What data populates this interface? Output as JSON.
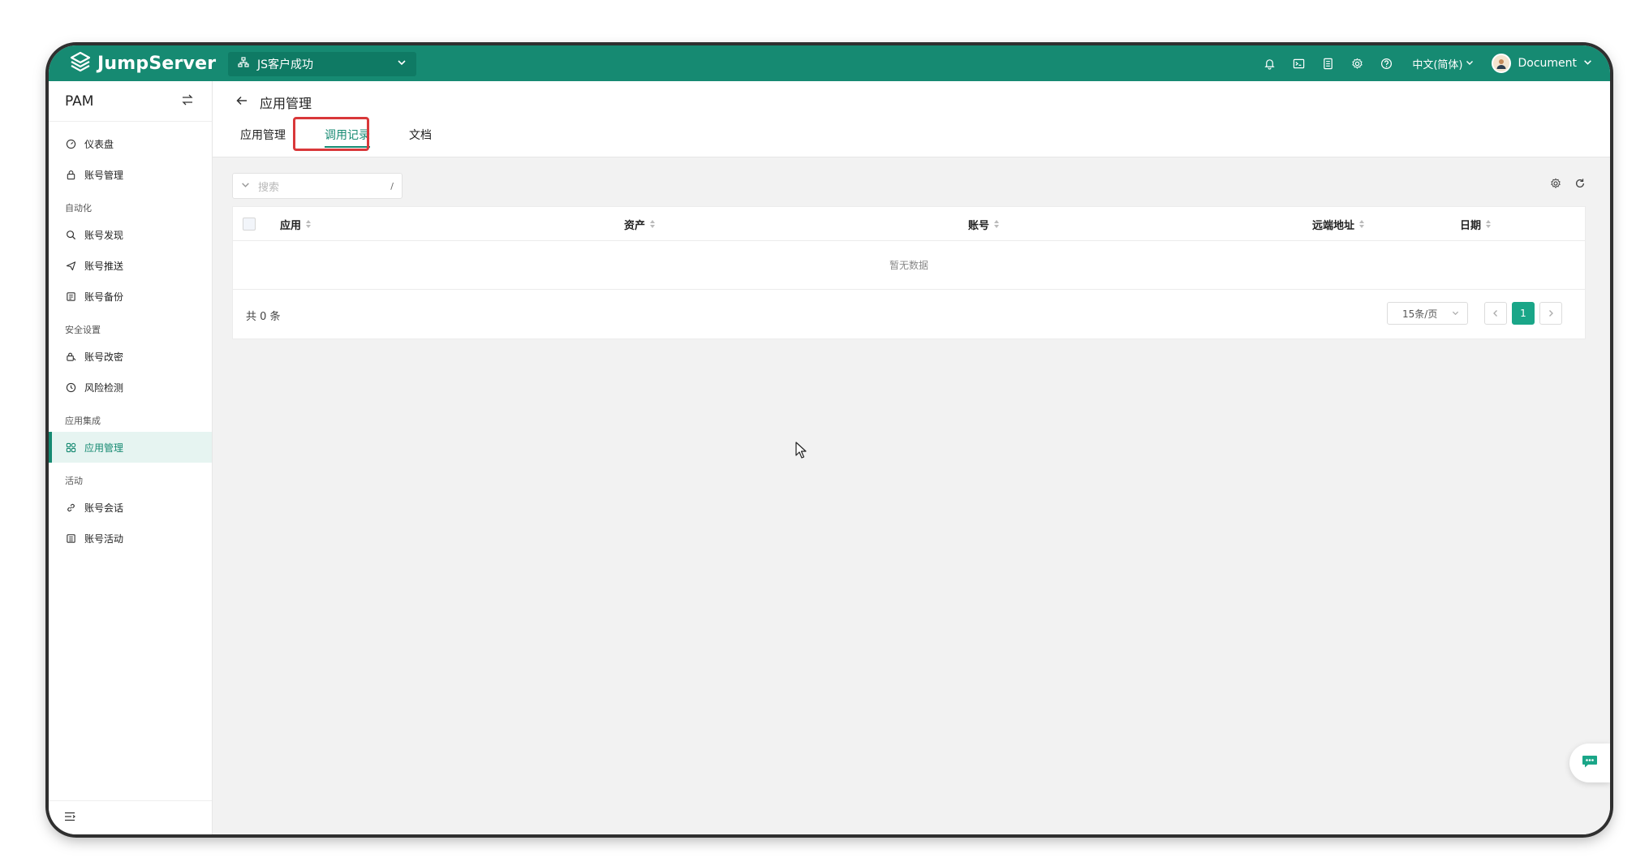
{
  "app": {
    "logo_text": "JumpServer"
  },
  "topbar": {
    "org": "JS客户成功",
    "language": "中文(简体)",
    "user": "Document",
    "icons": [
      "bell-icon",
      "terminal-icon",
      "document-list-icon",
      "gear-icon",
      "help-icon"
    ]
  },
  "sidebar": {
    "title": "PAM",
    "items_top": [
      {
        "label": "仪表盘",
        "icon": "dashboard-icon"
      },
      {
        "label": "账号管理",
        "icon": "lock-icon"
      }
    ],
    "groups": [
      {
        "title": "自动化",
        "items": [
          {
            "label": "账号发现",
            "icon": "search-icon"
          },
          {
            "label": "账号推送",
            "icon": "send-icon"
          },
          {
            "label": "账号备份",
            "icon": "backup-icon"
          }
        ]
      },
      {
        "title": "安全设置",
        "items": [
          {
            "label": "账号改密",
            "icon": "key-lock-icon"
          },
          {
            "label": "风险检测",
            "icon": "risk-clock-icon"
          }
        ]
      },
      {
        "title": "应用集成",
        "items": [
          {
            "label": "应用管理",
            "icon": "apps-grid-icon",
            "active": true
          }
        ]
      },
      {
        "title": "活动",
        "items": [
          {
            "label": "账号会话",
            "icon": "link-icon"
          },
          {
            "label": "账号活动",
            "icon": "activity-list-icon"
          }
        ]
      }
    ]
  },
  "page": {
    "title": "应用管理",
    "tabs": [
      {
        "label": "应用管理",
        "active": false
      },
      {
        "label": "调用记录",
        "active": true
      },
      {
        "label": "文档",
        "active": false
      }
    ],
    "search": {
      "placeholder": "搜索",
      "shortcut": "/"
    }
  },
  "table": {
    "columns": [
      "应用",
      "资产",
      "账号",
      "远端地址",
      "日期"
    ],
    "empty_text": "暂无数据",
    "total_text": "共 0 条",
    "page_size": "15条/页",
    "current_page": "1"
  },
  "colors": {
    "brand": "#168a72",
    "highlight": "#d9383a"
  }
}
